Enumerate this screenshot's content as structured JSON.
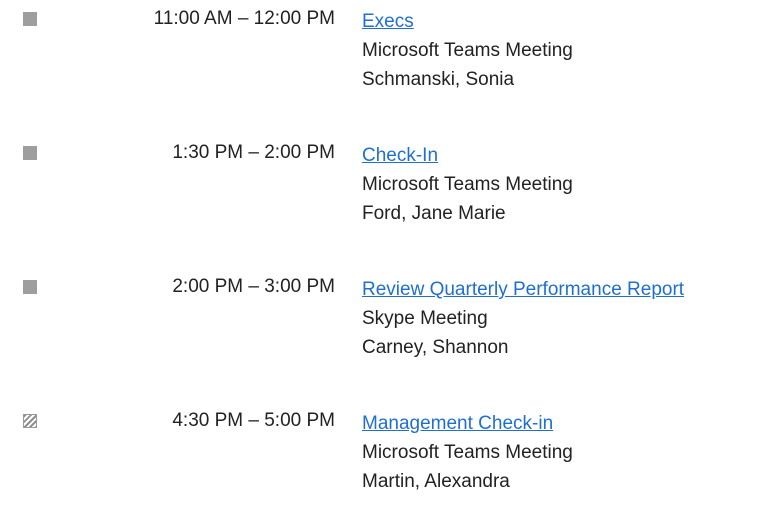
{
  "events": [
    {
      "time": "11:00 AM – 12:00 PM",
      "subject": "Execs",
      "location": "Microsoft Teams Meeting",
      "organizer": "Schmanski, Sonia",
      "status": "busy"
    },
    {
      "time": "1:30 PM – 2:00 PM",
      "subject": "Check-In",
      "location": "Microsoft Teams Meeting",
      "organizer": "Ford, Jane Marie",
      "status": "busy"
    },
    {
      "time": "2:00 PM – 3:00 PM",
      "subject": "Review Quarterly Performance Report",
      "location": "Skype Meeting",
      "organizer": "Carney, Shannon",
      "status": "busy"
    },
    {
      "time": "4:30 PM – 5:00 PM",
      "subject": "Management Check-in",
      "location": "Microsoft Teams Meeting",
      "organizer": "Martin, Alexandra",
      "status": "tentative"
    }
  ],
  "colors": {
    "link": "#1f6fd1",
    "busy_icon": "#9e9e9e",
    "text": "#222222"
  }
}
